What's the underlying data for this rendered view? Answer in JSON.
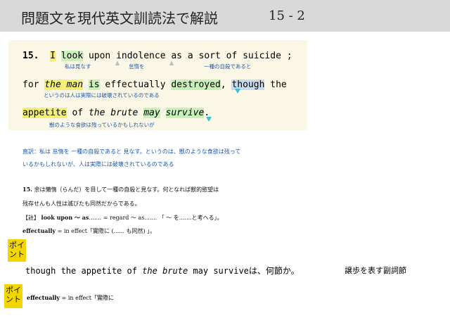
{
  "header": {
    "title": "問題文を現代英文訓読法で解説",
    "page": "15 - 2"
  },
  "sentence": {
    "number": "15.",
    "line1": {
      "w1": "I",
      "w2": "look",
      "w3": "upon",
      "w4": "indolence",
      "w5": "as a sort of suicide",
      "end": ";"
    },
    "line2": {
      "w1": "for",
      "w2": "the man",
      "w3": "is",
      "w4": "effectually",
      "w5": "destroyed",
      "comma": ",",
      "w6": "though",
      "w7": "the"
    },
    "line3": {
      "w1": "appetite",
      "w2": "of",
      "w3": "the brute",
      "w4": "may",
      "w5": "survive",
      "end": "."
    }
  },
  "glosses": {
    "g1": "私は見なす",
    "g2": "怠惰を",
    "g3": "一種の自殺であると",
    "g4": "というのは人は実際には破壊されているのである",
    "g5": "獣のような食欲は残っているかもしれないが"
  },
  "literal": {
    "line1": "直訳：私は 怠惰を 一種の自殺であると 見なす。というのは、獣のような食欲は残って",
    "line2": "いるかもしれないが、人は実際には破壊されているのである"
  },
  "translation": {
    "line1_num": "15.",
    "line1": "余は懶惰（らんだ）を目して一種の自殺と見なす。何となれば獣的慾望は",
    "line2": "残存せんも人性は滅びたも同然だからである。",
    "note1_prefix": "【註】",
    "note1_bold": "look upon ～ as",
    "note1_rest": "....... = regard ～ as....... 「 ～ を.......と考へる」。",
    "note2_bold": "effectually",
    "note2_rest": " = in effect「實際に (...... も同然) 」。"
  },
  "points": [
    {
      "label1": "ポイ",
      "label2": "ント",
      "text_pre": "though the appetite of ",
      "text_italic": "the brute",
      "text_mid": " may survive",
      "text_jp": "は、何節か。",
      "answer": "譲歩を表す副詞節"
    },
    {
      "label1": "ポイ",
      "label2": "ント",
      "text_bold": "effectually",
      "text_rest": " = in effect「實際に"
    }
  ],
  "colors": {
    "header_bg": "#d9d9d9",
    "panel_bg": "#fbf7e6",
    "gloss": "#1f58a6",
    "point_bg": "#f3d600",
    "highlight_green": "#c9f0b8",
    "highlight_yellow": "#f3ef78"
  }
}
